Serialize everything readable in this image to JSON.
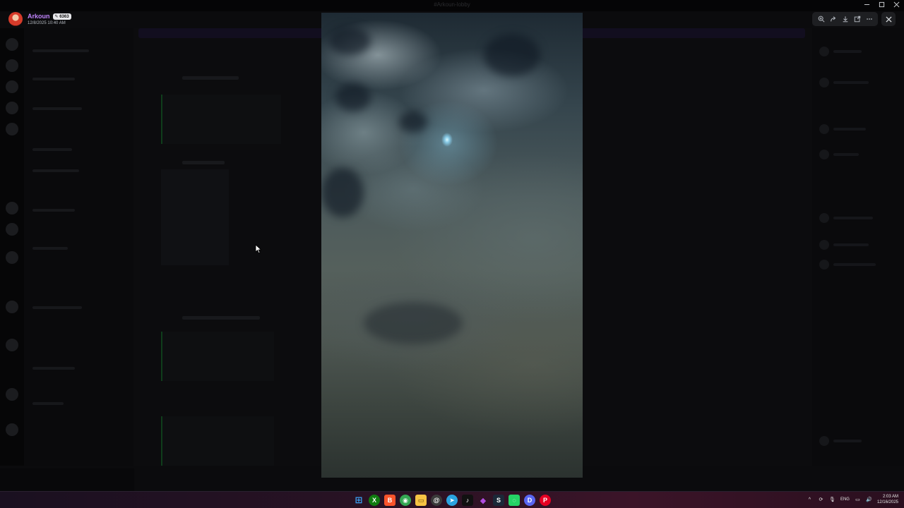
{
  "window": {
    "title": "#Arkoun-lobby"
  },
  "author": {
    "name": "Arkoun",
    "badge": "6363",
    "badge_icon": "feather-icon",
    "timestamp": "12/8/2025 10:40 AM"
  },
  "viewer_tools": [
    {
      "icon": "zoom-in-icon",
      "label": "Zoom"
    },
    {
      "icon": "forward-icon",
      "label": "Forward"
    },
    {
      "icon": "download-icon",
      "label": "Download"
    },
    {
      "icon": "open-in-browser-icon",
      "label": "Open in Browser"
    },
    {
      "icon": "more-icon",
      "label": "More"
    }
  ],
  "close_icon": "close-icon",
  "media": {
    "kind": "image"
  },
  "taskbar": {
    "apps": [
      {
        "icon": "windows-start-icon",
        "color": "#3aa0f3",
        "glyph": "⊞"
      },
      {
        "icon": "xbox-icon",
        "color": "#107c10",
        "glyph": "X"
      },
      {
        "icon": "brave-icon",
        "color": "#fb542b",
        "glyph": "B"
      },
      {
        "icon": "chrome-icon",
        "color": "#34a853",
        "glyph": "◉"
      },
      {
        "icon": "file-explorer-icon",
        "color": "#f6c344",
        "glyph": "▭"
      },
      {
        "icon": "threads-icon",
        "color": "#3a3a3a",
        "glyph": "@"
      },
      {
        "icon": "telegram-icon",
        "color": "#2aa3e0",
        "glyph": "➤"
      },
      {
        "icon": "tiktok-icon",
        "color": "#111111",
        "glyph": "♪"
      },
      {
        "icon": "obsidian-icon",
        "color": "#b04de0",
        "glyph": "◆"
      },
      {
        "icon": "steam-icon",
        "color": "#1b2838",
        "glyph": "S"
      },
      {
        "icon": "whatsapp-icon",
        "color": "#25d366",
        "glyph": "◌"
      },
      {
        "icon": "discord-icon",
        "color": "#5865f2",
        "glyph": "D"
      },
      {
        "icon": "pinterest-icon",
        "color": "#e60023",
        "glyph": "P"
      }
    ],
    "tray": {
      "language": "ENG",
      "time": "2:03 AM",
      "date": "12/16/2025"
    }
  }
}
